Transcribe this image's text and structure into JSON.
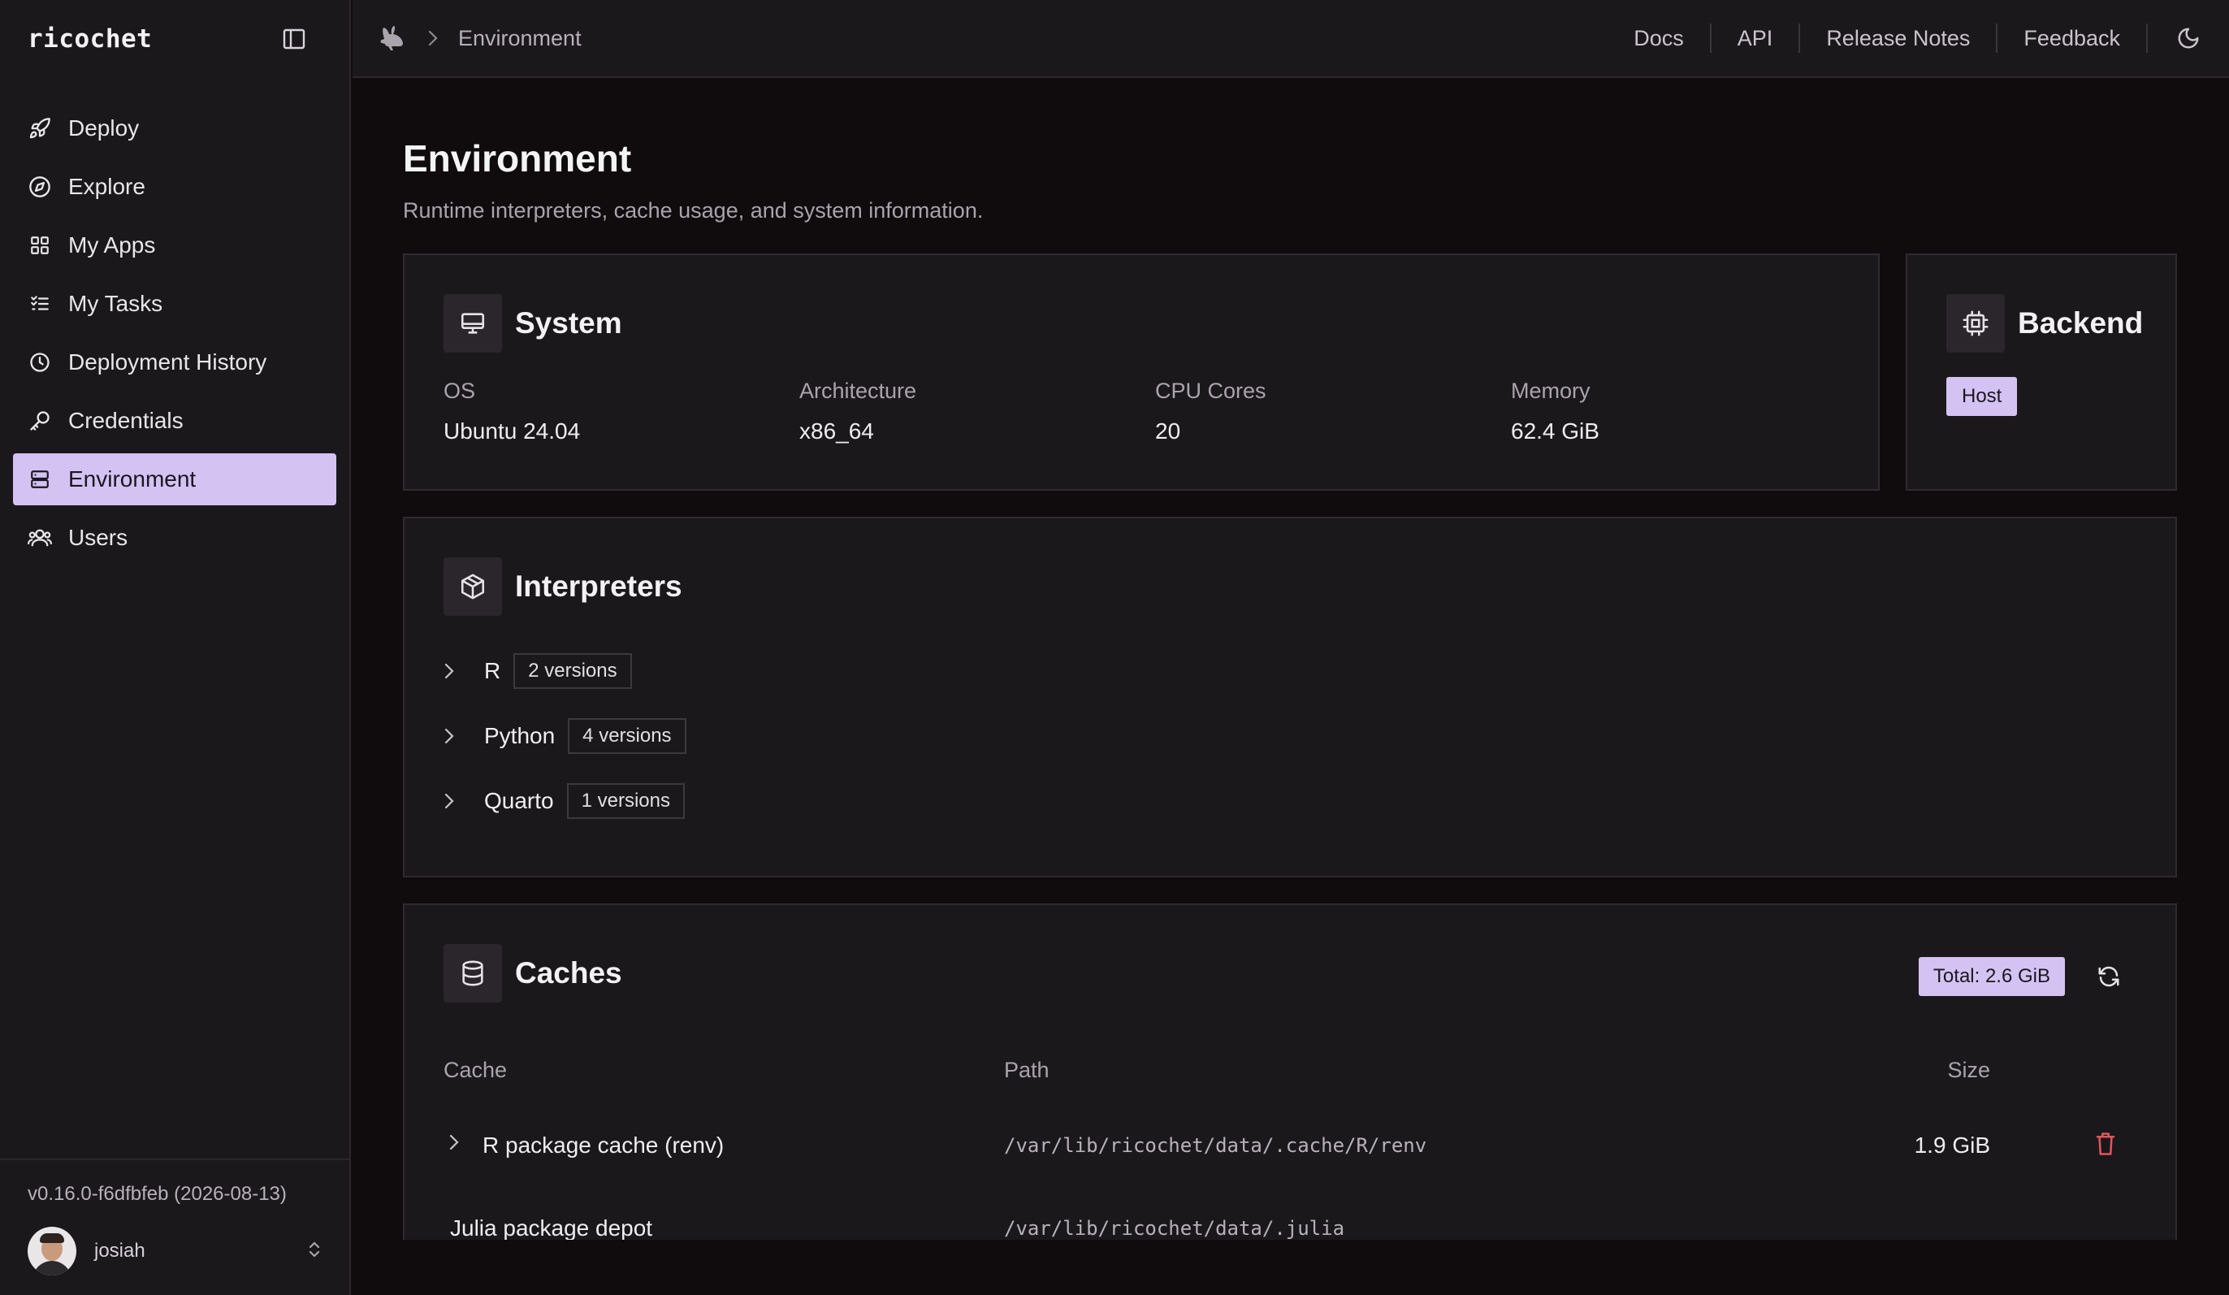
{
  "app": {
    "brand": "ricochet"
  },
  "sidebar": {
    "items": [
      {
        "label": "Deploy",
        "icon": "rocket-icon"
      },
      {
        "label": "Explore",
        "icon": "compass-icon"
      },
      {
        "label": "My Apps",
        "icon": "grid-icon"
      },
      {
        "label": "My Tasks",
        "icon": "list-checks-icon"
      },
      {
        "label": "Deployment History",
        "icon": "history-icon"
      },
      {
        "label": "Credentials",
        "icon": "key-icon"
      },
      {
        "label": "Environment",
        "icon": "server-icon",
        "active": true
      },
      {
        "label": "Users",
        "icon": "users-icon"
      }
    ],
    "version": "v0.16.0-f6dfbfeb (2026-08-13)",
    "user": {
      "name": "josiah"
    }
  },
  "topbar": {
    "breadcrumb_current": "Environment",
    "links": [
      "Docs",
      "API",
      "Release Notes",
      "Feedback"
    ]
  },
  "page": {
    "title": "Environment",
    "subtitle": "Runtime interpreters, cache usage, and system information."
  },
  "system": {
    "title": "System",
    "fields": [
      {
        "label": "OS",
        "value": "Ubuntu 24.04"
      },
      {
        "label": "Architecture",
        "value": "x86_64"
      },
      {
        "label": "CPU Cores",
        "value": "20"
      },
      {
        "label": "Memory",
        "value": "62.4 GiB"
      }
    ]
  },
  "backend": {
    "title": "Backend",
    "badge": "Host"
  },
  "interpreters": {
    "title": "Interpreters",
    "items": [
      {
        "name": "R",
        "versions": "2 versions"
      },
      {
        "name": "Python",
        "versions": "4 versions"
      },
      {
        "name": "Quarto",
        "versions": "1 versions"
      }
    ]
  },
  "caches": {
    "title": "Caches",
    "total": "Total: 2.6 GiB",
    "headers": {
      "cache": "Cache",
      "path": "Path",
      "size": "Size"
    },
    "rows": [
      {
        "cache": "R package cache (renv)",
        "path": "/var/lib/ricochet/data/.cache/R/renv",
        "size": "1.9 GiB"
      },
      {
        "cache": "Julia package depot",
        "path": "/var/lib/ricochet/data/.julia",
        "size": ""
      }
    ]
  },
  "colors": {
    "accent": "#d4c3f2",
    "danger": "#e0565b",
    "background": "#100c0e",
    "surface": "#1b181c"
  }
}
